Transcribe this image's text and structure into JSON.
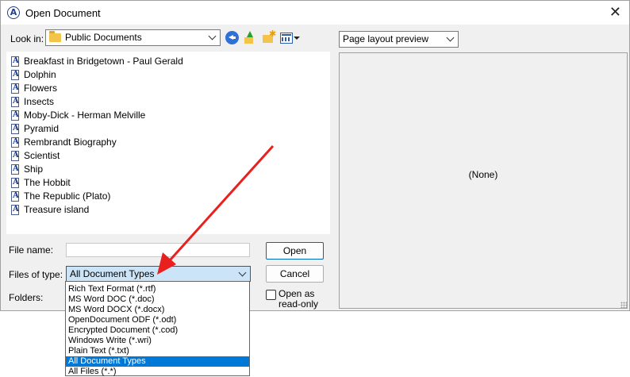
{
  "window": {
    "title": "Open Document",
    "app_icon": "app-a-icon",
    "close_icon": "close-icon"
  },
  "lookin": {
    "label": "Look in:",
    "value": "Public Documents"
  },
  "toolbar": {
    "icons": [
      "back-icon",
      "up-folder-icon",
      "new-folder-icon",
      "view-menu-icon"
    ]
  },
  "files": [
    "Breakfast in Bridgetown - Paul Gerald",
    "Dolphin",
    "Flowers",
    "Insects",
    "Moby-Dick - Herman Melville",
    "Pyramid",
    "Rembrandt Biography",
    "Scientist",
    "Ship",
    "The Hobbit",
    "The Republic (Plato)",
    "Treasure island"
  ],
  "preview": {
    "mode": "Page layout preview",
    "content": "(None)"
  },
  "form": {
    "filename_label": "File name:",
    "filename_value": "",
    "filetype_label": "Files of type:",
    "filetype_value": "All Document Types",
    "folders_label": "Folders:",
    "open_button": "Open",
    "cancel_button": "Cancel",
    "readonly_label_1": "Open as",
    "readonly_label_2": "read-only",
    "readonly_checked": false
  },
  "filetype_options": [
    "Rich Text Format (*.rtf)",
    "MS Word DOC (*.doc)",
    "MS Word DOCX (*.docx)",
    "OpenDocument ODF (*.odt)",
    "Encrypted Document (*.cod)",
    "Windows Write (*.wri)",
    "Plain Text (*.txt)",
    "All Document Types",
    "All Files (*.*)"
  ],
  "filetype_selected_index": 7,
  "colors": {
    "accent": "#0078d7",
    "annotation_arrow": "#e8201e"
  }
}
